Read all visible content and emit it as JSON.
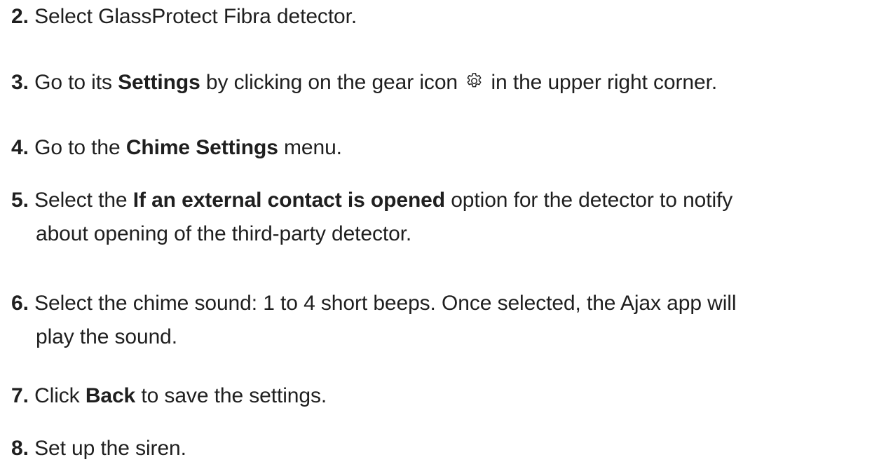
{
  "steps": [
    {
      "number": "2.",
      "parts": [
        "Select GlassProtect Fibra detector."
      ]
    },
    {
      "number": "3.",
      "parts": [
        "Go to its ",
        "Settings",
        " by clicking on the gear icon ",
        " in the upper right corner."
      ],
      "icon": "gear-icon"
    },
    {
      "number": "4.",
      "parts": [
        "Go to the ",
        "Chime Settings",
        " menu."
      ]
    },
    {
      "number": "5.",
      "parts": [
        "Select the ",
        "If an external contact is opened",
        " option for the detector to notify"
      ],
      "continuation": "about opening of the third-party detector."
    },
    {
      "number": "6.",
      "parts": [
        "Select the chime sound: 1 to 4 short beeps. Once selected, the Ajax app will"
      ],
      "continuation": "play the sound."
    },
    {
      "number": "7.",
      "parts": [
        "Click ",
        "Back",
        " to save the settings."
      ]
    },
    {
      "number": "8.",
      "parts": [
        "Set up the siren."
      ]
    }
  ]
}
